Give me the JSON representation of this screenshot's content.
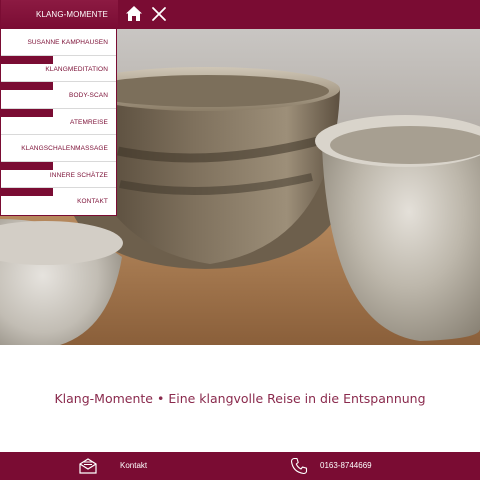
{
  "header": {
    "home_icon": "home-icon",
    "close_icon": "close-icon"
  },
  "menu": {
    "title": "KLANG-MOMENTE",
    "items": [
      {
        "label": "SUSANNE KAMPHAUSEN"
      },
      {
        "label": "KLANGMEDITATION"
      },
      {
        "label": "BODY-SCAN"
      },
      {
        "label": "ATEMREISE"
      },
      {
        "label": "KLANGSCHALENMASSAGE"
      },
      {
        "label": "INNERE SCHÄTZE"
      },
      {
        "label": "KONTAKT"
      }
    ]
  },
  "tagline": {
    "brand": "Klang-Momente",
    "separator": "•",
    "text": "Eine klangvolle Reise in die Entspannung"
  },
  "footer": {
    "contact_label": "Kontakt",
    "phone": "0163-8744669",
    "mail_icon": "mail-icon",
    "phone_icon": "phone-icon"
  },
  "colors": {
    "brand": "#7a0c33",
    "tagline": "#8a2a4d"
  }
}
